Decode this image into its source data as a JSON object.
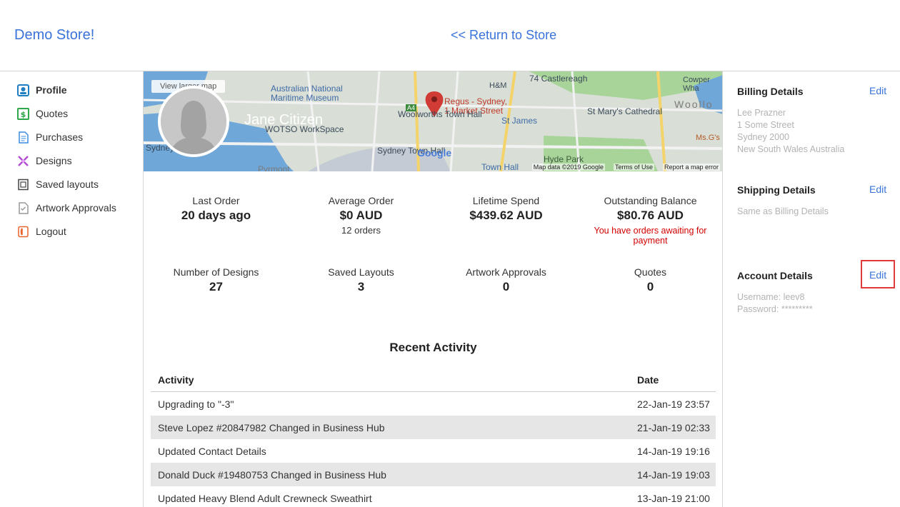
{
  "header": {
    "brand": "Demo Store!",
    "return_link": "<< Return to Store"
  },
  "sidebar": {
    "items": [
      {
        "label": "Profile",
        "icon": "profile-icon",
        "color": "#1f7ec2"
      },
      {
        "label": "Quotes",
        "icon": "dollar-icon",
        "color": "#2ea84a"
      },
      {
        "label": "Purchases",
        "icon": "document-icon",
        "color": "#3a8be0"
      },
      {
        "label": "Designs",
        "icon": "design-icon",
        "color": "#b24fd1"
      },
      {
        "label": "Saved layouts",
        "icon": "layout-icon",
        "color": "#444444"
      },
      {
        "label": "Artwork Approvals",
        "icon": "approval-icon",
        "color": "#999999"
      },
      {
        "label": "Logout",
        "icon": "logout-icon",
        "color": "#e8642c"
      }
    ]
  },
  "profile": {
    "name": "Jane Citizen",
    "map_button": "View larger map",
    "map_labels": {
      "museum": "Australian National\nMaritime Museum",
      "wotso": "WOTSO WorkSpace",
      "regus": "Regus - Sydney,\n1 Market Street",
      "castlereagh": "74 Castlereagh",
      "hm": "H&M",
      "st_james": "St James",
      "st_marys": "St Mary's Cathedral",
      "woolworths": "Woolworths Town Hall",
      "sydney_town_hall": "Sydney Town Hall",
      "hyde_park": "Hyde Park",
      "town_hall": "Town Hall",
      "sydney": "Sydney",
      "cowper": "Cowper Wha",
      "woollo": "Woollo",
      "msgs": "Ms.G's",
      "pyrmont": "Pyrmont",
      "google": "Google",
      "a4": "A4"
    },
    "map_footer": [
      "Map data ©2019 Google",
      "Terms of Use",
      "Report a map error"
    ]
  },
  "stats": {
    "row1": [
      {
        "label": "Last Order",
        "value": "20 days ago"
      },
      {
        "label": "Average Order",
        "value": "$0 AUD",
        "sub": "12 orders"
      },
      {
        "label": "Lifetime Spend",
        "value": "$439.62 AUD"
      },
      {
        "label": "Outstanding Balance",
        "value": "$80.76 AUD",
        "warning": "You have orders awaiting for payment"
      }
    ],
    "row2": [
      {
        "label": "Number of Designs",
        "value": "27"
      },
      {
        "label": "Saved Layouts",
        "value": "3"
      },
      {
        "label": "Artwork Approvals",
        "value": "0"
      },
      {
        "label": "Quotes",
        "value": "0"
      }
    ]
  },
  "recent_activity": {
    "title": "Recent Activity",
    "columns": [
      "Activity",
      "Date"
    ],
    "rows": [
      {
        "activity": "Upgrading to \"-3\"",
        "date": "22-Jan-19 23:57"
      },
      {
        "activity": "Steve Lopez #20847982 Changed in Business Hub",
        "date": "21-Jan-19 02:33"
      },
      {
        "activity": "Updated Contact Details",
        "date": "14-Jan-19 19:16"
      },
      {
        "activity": "Donald Duck #19480753 Changed in Business Hub",
        "date": "14-Jan-19 19:03"
      },
      {
        "activity": "Updated Heavy Blend Adult Crewneck Sweathirt",
        "date": "13-Jan-19 21:00"
      }
    ]
  },
  "billing": {
    "title": "Billing Details",
    "edit": "Edit",
    "lines": [
      "Lee Prazner",
      "1 Some Street",
      "Sydney 2000",
      "New South Wales Australia"
    ]
  },
  "shipping": {
    "title": "Shipping Details",
    "edit": "Edit",
    "lines": [
      "Same as Billing Details"
    ]
  },
  "account": {
    "title": "Account Details",
    "edit": "Edit",
    "username": "Username: leev8",
    "password": "Password: *********"
  },
  "colors": {
    "link": "#3a73d9",
    "warning": "#d40000",
    "highlight_border": "#e03a3a"
  }
}
